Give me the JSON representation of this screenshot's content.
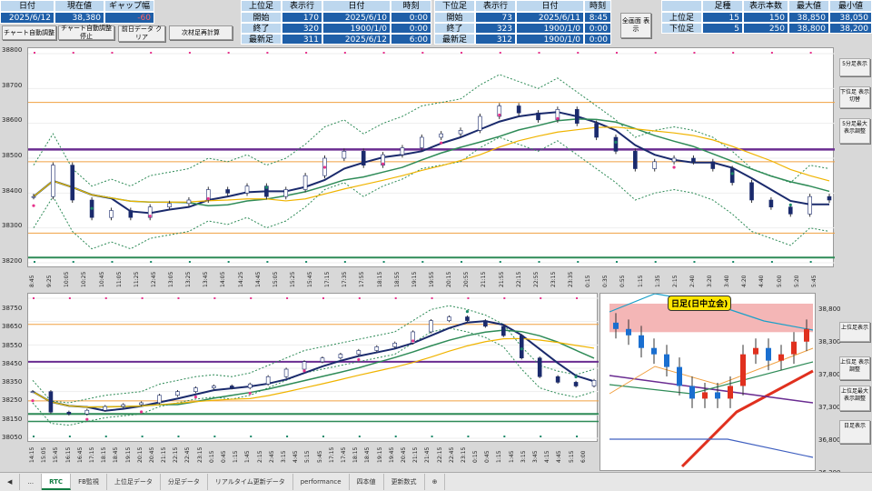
{
  "top_left": {
    "headers": [
      "日付",
      "現在値",
      "ギャップ幅"
    ],
    "values": [
      "2025/6/12",
      "38,380",
      "-60"
    ]
  },
  "upper_block": {
    "headers": [
      "上位足",
      "表示行",
      "日付",
      "時刻"
    ],
    "rows": [
      {
        "label": "開始",
        "row": "170",
        "date": "2025/6/10",
        "time": "0:00"
      },
      {
        "label": "終了",
        "row": "320",
        "date": "1900/1/0",
        "time": "0:00"
      },
      {
        "label": "最新足",
        "row": "311",
        "date": "2025/6/12",
        "time": "6:00"
      }
    ]
  },
  "lower_block": {
    "headers": [
      "下位足",
      "表示行",
      "日付",
      "時刻"
    ],
    "rows": [
      {
        "label": "開始",
        "row": "73",
        "date": "2025/6/11",
        "time": "8:45"
      },
      {
        "label": "終了",
        "row": "323",
        "date": "1900/1/0",
        "time": "0:00"
      },
      {
        "label": "最新足",
        "row": "312",
        "date": "1900/1/0",
        "time": "0:00"
      }
    ]
  },
  "right_block": {
    "headers": [
      "足種",
      "表示本数",
      "最大値",
      "最小値"
    ],
    "rows": [
      {
        "label": "上位足",
        "type": "15",
        "count": "150",
        "max": "38,850",
        "min": "38,050"
      },
      {
        "label": "下位足",
        "type": "5",
        "count": "250",
        "max": "38,800",
        "min": "38,200"
      }
    ]
  },
  "buttons": {
    "auto_adjust": "チャート自動調整",
    "auto_stop": "チャート自動調整停止",
    "clear_data": "前日データ クリア",
    "recalc": "次材足再計算",
    "fullscreen": "全画面 表示"
  },
  "side_buttons": {
    "upper": [
      "5分足表示",
      "下位足 表示切替",
      "5分足最大 表示調整"
    ],
    "lower": [
      "上位足表示",
      "上位足 表示調整",
      "上位足最大 表示調整",
      "日足表示"
    ]
  },
  "chart_top": {
    "yticks": [
      "38800",
      "38700",
      "38600",
      "38500",
      "38400",
      "38300",
      "38200"
    ],
    "xticks": [
      "8:45",
      "9:25",
      "10:05",
      "10:25",
      "10:45",
      "11:05",
      "11:25",
      "12:45",
      "13:05",
      "13:25",
      "13:45",
      "14:05",
      "14:25",
      "14:45",
      "15:05",
      "15:25",
      "15:45",
      "17:15",
      "17:35",
      "17:55",
      "18:15",
      "18:55",
      "19:15",
      "19:55",
      "20:15",
      "20:55",
      "21:15",
      "21:55",
      "22:15",
      "22:55",
      "23:15",
      "23:35",
      "0:15",
      "0:35",
      "0:55",
      "1:15",
      "1:35",
      "2:15",
      "2:40",
      "3:20",
      "3:40",
      "4:20",
      "4:40",
      "5:00",
      "5:20",
      "5:45"
    ]
  },
  "chart_bottom": {
    "yticks": [
      "38750",
      "38650",
      "38550",
      "38450",
      "38350",
      "38250",
      "38150",
      "38050"
    ],
    "xticks": [
      "14:15",
      "15:05",
      "15:45",
      "16:15",
      "16:45",
      "17:15",
      "18:15",
      "18:45",
      "19:15",
      "20:15",
      "20:45",
      "21:15",
      "22:15",
      "22:45",
      "23:15",
      "0:15",
      "0:45",
      "1:15",
      "1:45",
      "2:15",
      "2:45",
      "3:15",
      "4:45",
      "5:15",
      "5:45",
      "17:15",
      "17:45",
      "18:15",
      "18:45",
      "19:15",
      "19:45",
      "20:45",
      "21:15",
      "21:45",
      "22:15",
      "22:45",
      "23:15",
      "0:15",
      "0:45",
      "1:15",
      "1:45",
      "3:15",
      "3:45",
      "4:15",
      "4:45",
      "5:15",
      "6:00"
    ]
  },
  "daily_chart": {
    "title": "日足(日中立会)",
    "yticks": [
      "38,800",
      "38,300",
      "37,800",
      "37,300",
      "36,800",
      "36,300"
    ]
  },
  "tabs": [
    "RTC",
    "FB監視",
    "上位足データ",
    "分足データ",
    "リアルタイム更新データ",
    "performance",
    "四本値",
    "更新数式"
  ],
  "active_tab": "RTC",
  "chart_data": [
    {
      "type": "line",
      "title": "",
      "ylim": [
        38200,
        38800
      ],
      "series": [
        {
          "values": [
            38390,
            38480,
            38380,
            38330,
            38350,
            38330,
            38360,
            38370,
            38380,
            38410,
            38400,
            38420,
            38390,
            38410,
            38450,
            38500,
            38520,
            38480,
            38510,
            38530,
            38560,
            38570,
            38580,
            38620,
            38650,
            38630,
            38610,
            38640,
            38600,
            38560,
            38520,
            38470,
            38490,
            38500,
            38490,
            38470,
            38430,
            38380,
            38360,
            38340,
            38390,
            38380
          ]
        }
      ]
    },
    {
      "type": "line",
      "title": "",
      "ylim": [
        38050,
        38800
      ],
      "series": [
        {
          "values": [
            38300,
            38190,
            38180,
            38200,
            38220,
            38230,
            38240,
            38280,
            38300,
            38320,
            38330,
            38320,
            38340,
            38380,
            38420,
            38460,
            38480,
            38500,
            38520,
            38540,
            38560,
            38620,
            38680,
            38700,
            38680,
            38650,
            38600,
            38480,
            38380,
            38350,
            38330,
            38360
          ]
        }
      ]
    },
    {
      "type": "bar",
      "title": "日足(日中立会)",
      "ylim": [
        36300,
        39000
      ],
      "values": [
        38500,
        38400,
        38200,
        38100,
        37900,
        37600,
        37400,
        37500,
        37400,
        37600,
        38100,
        38200,
        38000,
        38100,
        38300,
        38500
      ]
    }
  ]
}
